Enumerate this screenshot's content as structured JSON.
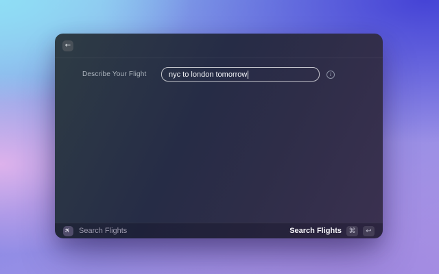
{
  "window": {
    "header": {
      "back_icon": "←"
    },
    "form": {
      "label": "Describe Your Flight",
      "input_value": "nyc to london tomorrow",
      "info_icon": "i"
    },
    "footer": {
      "left_label": "Search Flights",
      "plane_icon": "✈",
      "right_label": "Search Flights",
      "cmd_key": "⌘",
      "enter_key": "↩"
    }
  },
  "colors": {
    "window_top_left": "#2e3c45",
    "window_top_right": "#262c46",
    "window_bottom": "#3b3150",
    "bg_top_left": "#8fdef5",
    "bg_top_right": "#4543d6",
    "bg_bottom_left": "#ecb6ec",
    "bg_bottom_right": "#a18ae1",
    "input_border": "#ffffff",
    "label_text": "#aeb6bf"
  }
}
